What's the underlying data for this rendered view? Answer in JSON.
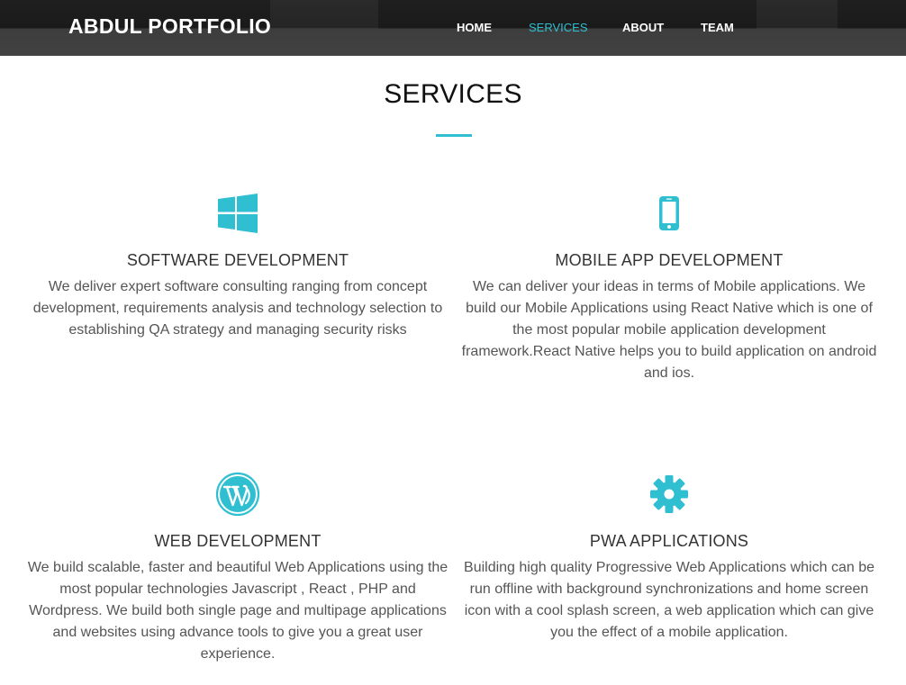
{
  "header": {
    "brand": "ABDUL PORTFOLIO",
    "nav": [
      {
        "label": "HOME",
        "active": false
      },
      {
        "label": "SERVICES",
        "active": true
      },
      {
        "label": "ABOUT",
        "active": false
      },
      {
        "label": "TEAM",
        "active": false
      }
    ]
  },
  "section": {
    "title": "SERVICES"
  },
  "services": [
    {
      "icon": "windows-icon",
      "title": "SOFTWARE DEVELOPMENT",
      "description": "We deliver expert software consulting ranging from concept development, requirements analysis and technology selection to establishing QA strategy and managing security risks"
    },
    {
      "icon": "mobile-phone-icon",
      "title": "MOBILE APP DEVELOPMENT",
      "description": "We can deliver your ideas in terms of Mobile applications. We build our Mobile Applications using React Native which is one of the most popular mobile application development framework.React Native helps you to build application on android and ios."
    },
    {
      "icon": "wordpress-icon",
      "title": "WEB DEVELOPMENT",
      "description": "We build scalable, faster and beautiful Web Applications using the most popular technologies Javascript , React , PHP and Wordpress. We build both single page and multipage applications and websites using advance tools to give you a great user experience."
    },
    {
      "icon": "gear-icon",
      "title": "PWA APPLICATIONS",
      "description": "Building high quality Progressive Web Applications which can be run offline with background synchronizations and home screen icon with a cool splash screen, a web application which can give you the effect of a mobile application."
    }
  ],
  "colors": {
    "accent": "#2fbfd1",
    "navbar": "#2b2b2b",
    "heading": "#333333",
    "body_text": "#555555"
  }
}
